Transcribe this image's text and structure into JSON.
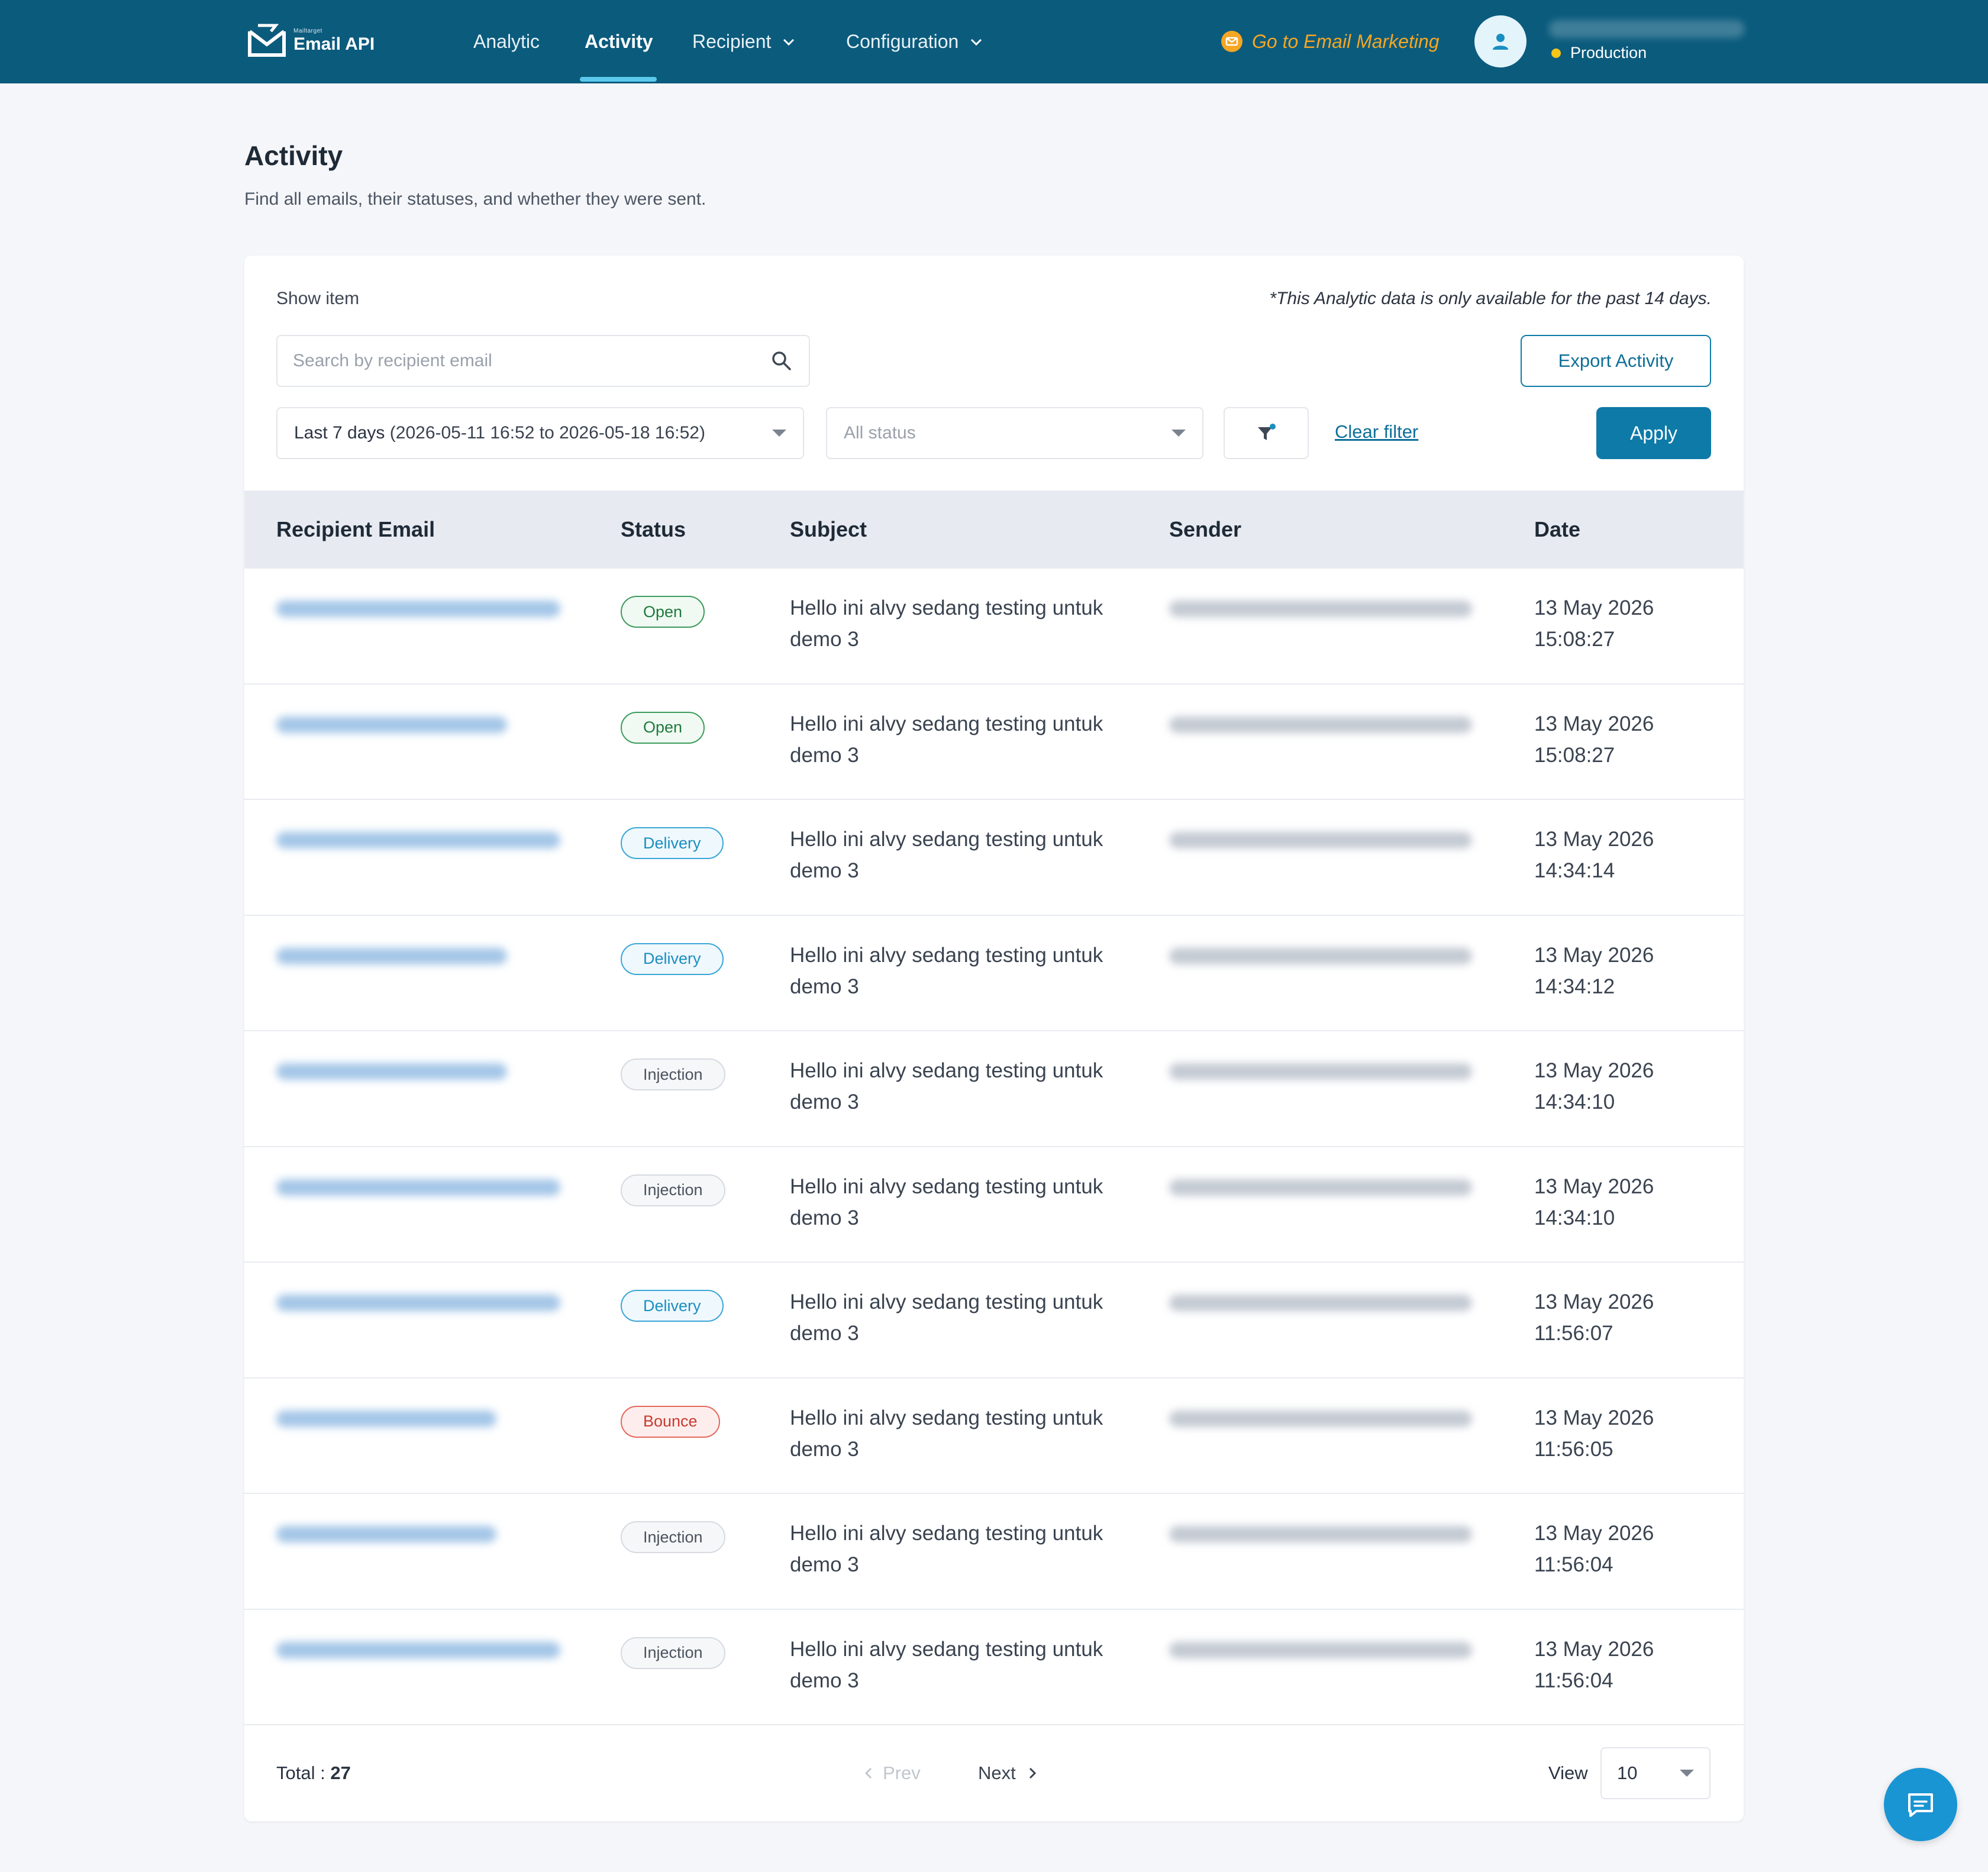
{
  "brand": {
    "small": "Mailtarget",
    "name": "Email API"
  },
  "nav": {
    "items": [
      {
        "label": "Analytic"
      },
      {
        "label": "Activity"
      },
      {
        "label": "Recipient"
      },
      {
        "label": "Configuration"
      }
    ],
    "marketing_link": "Go to Email Marketing",
    "environment": "Production"
  },
  "page": {
    "title": "Activity",
    "subtitle": "Find all emails, their statuses, and whether they were sent."
  },
  "filters": {
    "show_item": "Show item",
    "notice": "*This Analytic data is only available for the past 14 days.",
    "search_placeholder": "Search by recipient email",
    "export_label": "Export Activity",
    "date_label": "Last 7 days",
    "date_range": "(2026-05-11 16:52 to 2026-05-18 16:52)",
    "status_placeholder": "All status",
    "clear_label": "Clear filter",
    "apply_label": "Apply"
  },
  "table": {
    "columns": [
      "Recipient Email",
      "Status",
      "Subject",
      "Sender",
      "Date"
    ],
    "rows": [
      {
        "status": "Open",
        "subject": "Hello ini alvy sedang testing untuk demo 3",
        "date": "13 May 2026",
        "time": "15:08:27"
      },
      {
        "status": "Open",
        "subject": "Hello ini alvy sedang testing untuk demo 3",
        "date": "13 May 2026",
        "time": "15:08:27"
      },
      {
        "status": "Delivery",
        "subject": "Hello ini alvy sedang testing untuk demo 3",
        "date": "13 May 2026",
        "time": "14:34:14"
      },
      {
        "status": "Delivery",
        "subject": "Hello ini alvy sedang testing untuk demo 3",
        "date": "13 May 2026",
        "time": "14:34:12"
      },
      {
        "status": "Injection",
        "subject": "Hello ini alvy sedang testing untuk demo 3",
        "date": "13 May 2026",
        "time": "14:34:10"
      },
      {
        "status": "Injection",
        "subject": "Hello ini alvy sedang testing untuk demo 3",
        "date": "13 May 2026",
        "time": "14:34:10"
      },
      {
        "status": "Delivery",
        "subject": "Hello ini alvy sedang testing untuk demo 3",
        "date": "13 May 2026",
        "time": "11:56:07"
      },
      {
        "status": "Bounce",
        "subject": "Hello ini alvy sedang testing untuk demo 3",
        "date": "13 May 2026",
        "time": "11:56:05"
      },
      {
        "status": "Injection",
        "subject": "Hello ini alvy sedang testing untuk demo 3",
        "date": "13 May 2026",
        "time": "11:56:04"
      },
      {
        "status": "Injection",
        "subject": "Hello ini alvy sedang testing untuk demo 3",
        "date": "13 May 2026",
        "time": "11:56:04"
      }
    ]
  },
  "pagination": {
    "total_label": "Total :",
    "total": "27",
    "prev_label": "Prev",
    "next_label": "Next",
    "view_label": "View",
    "view_value": "10"
  },
  "colors": {
    "navbar": "#0b5b7d",
    "accent": "#0e7aa8",
    "marketing": "#f5a623",
    "open": "#1f7a3d",
    "delivery": "#1a8ec0",
    "injection": "#4b535e",
    "bounce": "#c93a2f"
  },
  "icons": [
    "logo-icon",
    "chevron-down-icon",
    "email-marketing-icon",
    "user-icon",
    "search-icon",
    "caret-down-icon",
    "filter-icon",
    "chevron-left-icon",
    "chevron-right-icon",
    "chat-icon"
  ]
}
